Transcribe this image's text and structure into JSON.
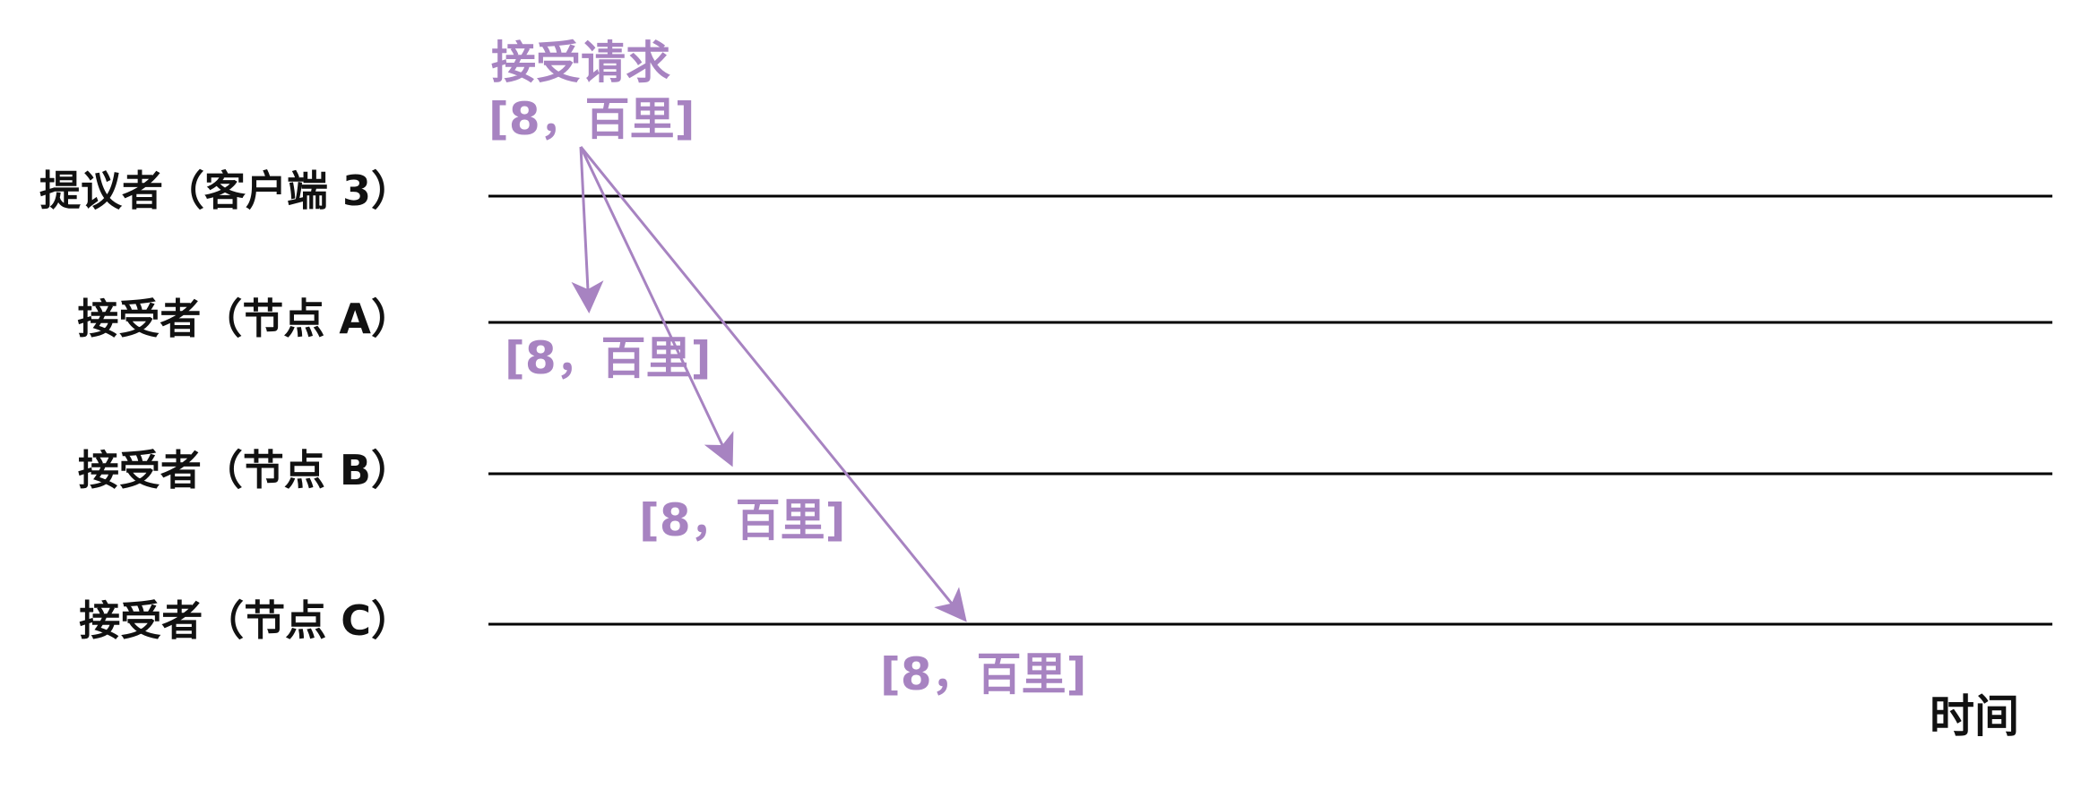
{
  "diagram": {
    "actors": [
      {
        "id": "proposer",
        "label": "提议者（客户端 3）"
      },
      {
        "id": "acceptor_a",
        "label": "接受者（节点 A）"
      },
      {
        "id": "acceptor_b",
        "label": "接受者（节点 B）"
      },
      {
        "id": "acceptor_c",
        "label": "接受者（节点 C）"
      }
    ],
    "request": {
      "title": "接受请求",
      "value": "[8，百里]"
    },
    "messages": [
      {
        "from": "proposer",
        "to": "acceptor_a",
        "label": "[8，百里]"
      },
      {
        "from": "proposer",
        "to": "acceptor_b",
        "label": "[8，百里]"
      },
      {
        "from": "proposer",
        "to": "acceptor_c",
        "label": "[8，百里]"
      }
    ],
    "time_label": "时间",
    "colors": {
      "timeline": "#000000",
      "accent": "#a783c1",
      "text": "#111111"
    }
  }
}
